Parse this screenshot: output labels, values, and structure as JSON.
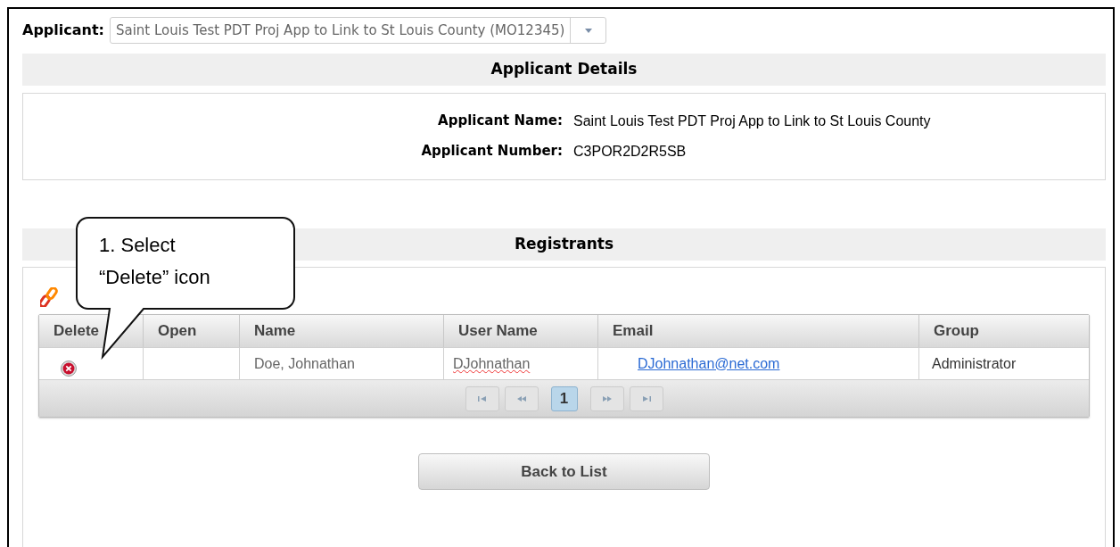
{
  "applicant_select": {
    "label": "Applicant:",
    "value": "Saint Louis Test PDT Proj App to Link to St Louis County (MO12345)"
  },
  "applicant_details": {
    "title": "Applicant Details",
    "fields": [
      {
        "label": "Applicant Name:",
        "value": "Saint Louis Test PDT Proj App to Link to St Louis County"
      },
      {
        "label": "Applicant Number:",
        "value": "C3POR2D2R5SB"
      }
    ]
  },
  "registrants": {
    "title": "Registrants",
    "table": {
      "columns": [
        "Delete",
        "Open",
        "Name",
        "User Name",
        "Email",
        "Group"
      ],
      "rows": [
        {
          "name": "Doe, Johnathan",
          "user_name": "DJohnathan",
          "user_name_misspelled": true,
          "email": "DJohnathan@net.com",
          "group": "Administrator"
        }
      ]
    },
    "pages": [
      {
        "label": "1",
        "selected": true
      }
    ]
  },
  "back_button": "Back to List",
  "callout": {
    "text": "1. Select “Delete” icon"
  }
}
